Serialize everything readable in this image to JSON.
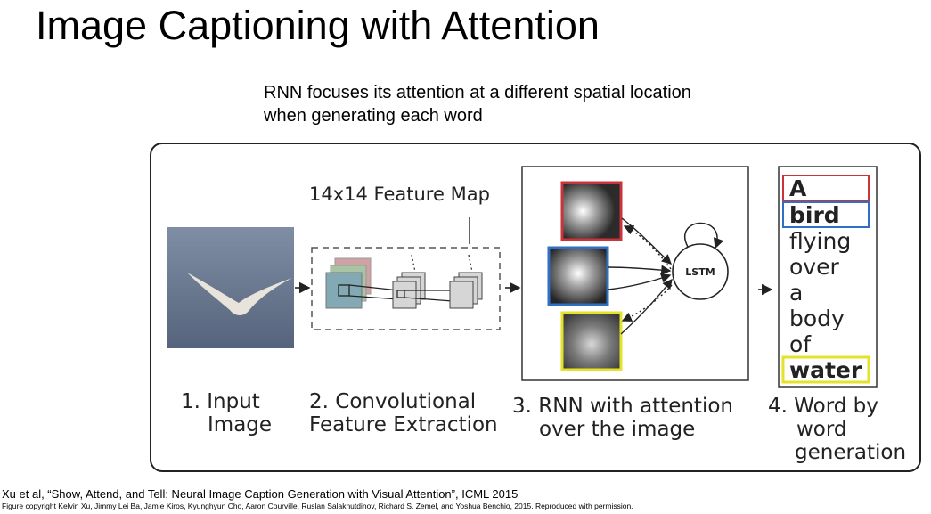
{
  "slide": {
    "title": "Image Captioning with Attention",
    "subtitle_line1": "RNN focuses its attention at a different spatial location",
    "subtitle_line2": "when generating each word"
  },
  "diagram": {
    "feature_map_label": "14x14 Feature Map",
    "lstm_label": "LSTM",
    "words": [
      "A",
      "bird",
      "flying",
      "over",
      "a",
      "body",
      "of",
      "water"
    ],
    "highlighted_words": [
      {
        "word": "A",
        "color": "#c9343a"
      },
      {
        "word": "bird",
        "color": "#2f6fc4"
      },
      {
        "word": "water",
        "color": "#e5e22a"
      }
    ],
    "attention_colors": [
      "#c9343a",
      "#2f6fc4",
      "#e5e22a"
    ],
    "stages": [
      {
        "line1": "1. Input",
        "line2": "Image"
      },
      {
        "line1": "2. Convolutional",
        "line2": "Feature Extraction"
      },
      {
        "line1": "3. RNN with attention",
        "line2": "over the image"
      },
      {
        "line1": "4. Word by",
        "line2": "word",
        "line3": "generation"
      }
    ]
  },
  "footer": {
    "citation": "Xu et al, “Show, Attend, and Tell: Neural Image Caption Generation with Visual Attention”, ICML 2015",
    "copyright": "Figure copyright Kelvin Xu, Jimmy Lei Ba, Jamie Kiros, Kyunghyun Cho, Aaron Courville, Ruslan Salakhutdinov, Richard S. Zemel, and Yoshua Benchio, 2015. Reproduced with permission."
  }
}
